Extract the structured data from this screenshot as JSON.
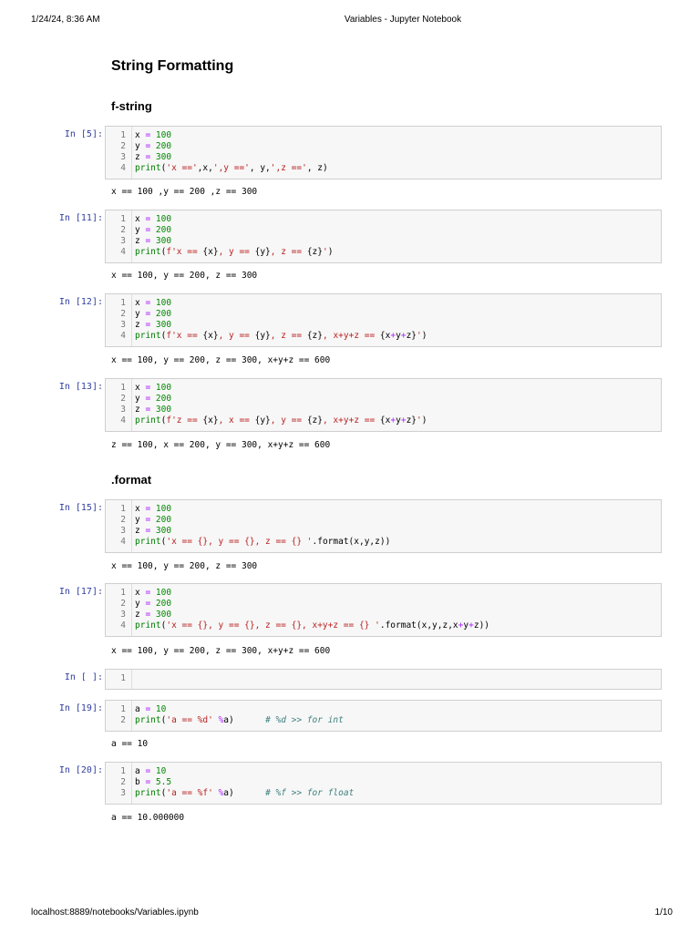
{
  "page_header": {
    "datetime": "1/24/24, 8:36 AM",
    "title": "Variables - Jupyter Notebook"
  },
  "page_footer": {
    "url": "localhost:8889/notebooks/Variables.ipynb",
    "page": "1/10"
  },
  "headings": {
    "main": "String Formatting",
    "fstring": "f-string",
    "format": ".format"
  },
  "cells": [
    {
      "prompt": "In [5]:",
      "lines": [
        [
          [
            "n",
            "x "
          ],
          [
            "o",
            "="
          ],
          [
            "num",
            " 100"
          ]
        ],
        [
          [
            "n",
            "y "
          ],
          [
            "o",
            "="
          ],
          [
            "num",
            " 200"
          ]
        ],
        [
          [
            "n",
            "z "
          ],
          [
            "o",
            "="
          ],
          [
            "num",
            " 300"
          ]
        ],
        [
          [
            "b",
            "print"
          ],
          [
            "n",
            "("
          ],
          [
            "s",
            "'x =='"
          ],
          [
            "n",
            ",x,"
          ],
          [
            "s",
            "',y =='"
          ],
          [
            "n",
            ", y,"
          ],
          [
            "s",
            "',z =='"
          ],
          [
            "n",
            ", z)"
          ]
        ]
      ],
      "output": "x == 100 ,y == 200 ,z == 300"
    },
    {
      "prompt": "In [11]:",
      "lines": [
        [
          [
            "n",
            "x "
          ],
          [
            "o",
            "="
          ],
          [
            "num",
            " 100"
          ]
        ],
        [
          [
            "n",
            "y "
          ],
          [
            "o",
            "="
          ],
          [
            "num",
            " 200"
          ]
        ],
        [
          [
            "n",
            "z "
          ],
          [
            "o",
            "="
          ],
          [
            "num",
            " 300"
          ]
        ],
        [
          [
            "b",
            "print"
          ],
          [
            "n",
            "("
          ],
          [
            "s",
            "f'x == "
          ],
          [
            "n",
            "{x}"
          ],
          [
            "s",
            ", y == "
          ],
          [
            "n",
            "{y}"
          ],
          [
            "s",
            ", z == "
          ],
          [
            "n",
            "{z}"
          ],
          [
            "s",
            "'"
          ],
          [
            "n",
            ")"
          ]
        ]
      ],
      "output": "x == 100, y == 200, z == 300"
    },
    {
      "prompt": "In [12]:",
      "lines": [
        [
          [
            "n",
            "x "
          ],
          [
            "o",
            "="
          ],
          [
            "num",
            " 100"
          ]
        ],
        [
          [
            "n",
            "y "
          ],
          [
            "o",
            "="
          ],
          [
            "num",
            " 200"
          ]
        ],
        [
          [
            "n",
            "z "
          ],
          [
            "o",
            "="
          ],
          [
            "num",
            " 300"
          ]
        ],
        [
          [
            "b",
            "print"
          ],
          [
            "n",
            "("
          ],
          [
            "s",
            "f'x == "
          ],
          [
            "n",
            "{x}"
          ],
          [
            "s",
            ", y == "
          ],
          [
            "n",
            "{y}"
          ],
          [
            "s",
            ", z == "
          ],
          [
            "n",
            "{z}"
          ],
          [
            "s",
            ", x+y+z == "
          ],
          [
            "n",
            "{x"
          ],
          [
            "o",
            "+"
          ],
          [
            "n",
            "y"
          ],
          [
            "o",
            "+"
          ],
          [
            "n",
            "z}"
          ],
          [
            "s",
            "'"
          ],
          [
            "n",
            ")"
          ]
        ]
      ],
      "output": "x == 100, y == 200, z == 300, x+y+z == 600"
    },
    {
      "prompt": "In [13]:",
      "lines": [
        [
          [
            "n",
            "x "
          ],
          [
            "o",
            "="
          ],
          [
            "num",
            " 100"
          ]
        ],
        [
          [
            "n",
            "y "
          ],
          [
            "o",
            "="
          ],
          [
            "num",
            " 200"
          ]
        ],
        [
          [
            "n",
            "z "
          ],
          [
            "o",
            "="
          ],
          [
            "num",
            " 300"
          ]
        ],
        [
          [
            "b",
            "print"
          ],
          [
            "n",
            "("
          ],
          [
            "s",
            "f'z == "
          ],
          [
            "n",
            "{x}"
          ],
          [
            "s",
            ", x == "
          ],
          [
            "n",
            "{y}"
          ],
          [
            "s",
            ", y == "
          ],
          [
            "n",
            "{z}"
          ],
          [
            "s",
            ", x+y+z == "
          ],
          [
            "n",
            "{x"
          ],
          [
            "o",
            "+"
          ],
          [
            "n",
            "y"
          ],
          [
            "o",
            "+"
          ],
          [
            "n",
            "z}"
          ],
          [
            "s",
            "'"
          ],
          [
            "n",
            ")"
          ]
        ]
      ],
      "output": "z == 100, x == 200, y == 300, x+y+z == 600"
    },
    {
      "prompt": "In [15]:",
      "lines": [
        [
          [
            "n",
            "x "
          ],
          [
            "o",
            "="
          ],
          [
            "num",
            " 100"
          ]
        ],
        [
          [
            "n",
            "y "
          ],
          [
            "o",
            "="
          ],
          [
            "num",
            " 200"
          ]
        ],
        [
          [
            "n",
            "z "
          ],
          [
            "o",
            "="
          ],
          [
            "num",
            " 300"
          ]
        ],
        [
          [
            "b",
            "print"
          ],
          [
            "n",
            "("
          ],
          [
            "s",
            "'x == {}, y == {}, z == {} '"
          ],
          [
            "n",
            ".format(x,y,z))"
          ]
        ]
      ],
      "output": "x == 100, y == 200, z == 300"
    },
    {
      "prompt": "In [17]:",
      "lines": [
        [
          [
            "n",
            "x "
          ],
          [
            "o",
            "="
          ],
          [
            "num",
            " 100"
          ]
        ],
        [
          [
            "n",
            "y "
          ],
          [
            "o",
            "="
          ],
          [
            "num",
            " 200"
          ]
        ],
        [
          [
            "n",
            "z "
          ],
          [
            "o",
            "="
          ],
          [
            "num",
            " 300"
          ]
        ],
        [
          [
            "b",
            "print"
          ],
          [
            "n",
            "("
          ],
          [
            "s",
            "'x == {}, y == {}, z == {}, x+y+z == {} '"
          ],
          [
            "n",
            ".format(x,y,z,x"
          ],
          [
            "o",
            "+"
          ],
          [
            "n",
            "y"
          ],
          [
            "o",
            "+"
          ],
          [
            "n",
            "z))"
          ]
        ]
      ],
      "output": "x == 100, y == 200, z == 300, x+y+z == 600"
    },
    {
      "prompt": "In [ ]:",
      "lines": [
        [
          [
            "n",
            ""
          ]
        ]
      ],
      "output": ""
    },
    {
      "prompt": "In [19]:",
      "lines": [
        [
          [
            "n",
            "a "
          ],
          [
            "o",
            "="
          ],
          [
            "num",
            " 10"
          ]
        ],
        [
          [
            "b",
            "print"
          ],
          [
            "n",
            "("
          ],
          [
            "s",
            "'a == %d'"
          ],
          [
            "n",
            " "
          ],
          [
            "o",
            "%"
          ],
          [
            "n",
            "a)      "
          ],
          [
            "c",
            "# %d >> for int"
          ]
        ]
      ],
      "output": "a == 10"
    },
    {
      "prompt": "In [20]:",
      "lines": [
        [
          [
            "n",
            "a "
          ],
          [
            "o",
            "="
          ],
          [
            "num",
            " 10"
          ]
        ],
        [
          [
            "n",
            "b "
          ],
          [
            "o",
            "="
          ],
          [
            "num",
            " 5.5"
          ]
        ],
        [
          [
            "b",
            "print"
          ],
          [
            "n",
            "("
          ],
          [
            "s",
            "'a == %f'"
          ],
          [
            "n",
            " "
          ],
          [
            "o",
            "%"
          ],
          [
            "n",
            "a)      "
          ],
          [
            "c",
            "# %f >> for float"
          ]
        ]
      ],
      "output": "a == 10.000000"
    }
  ]
}
